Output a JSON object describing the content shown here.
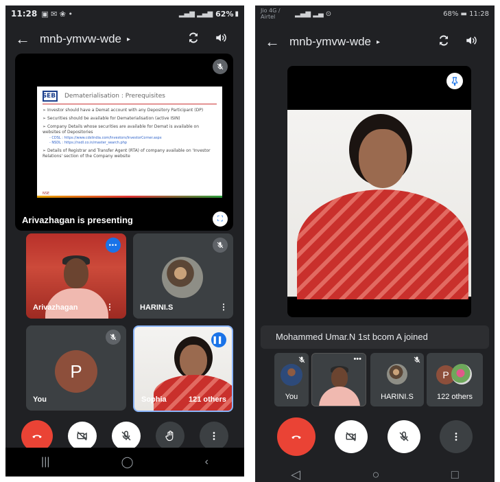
{
  "left": {
    "status": {
      "time": "11:28",
      "notif_glyphs": "▣ ✉ ❀ •",
      "battery": "62%"
    },
    "appbar": {
      "back_icon": "back-arrow-icon",
      "meeting_code": "mnb-ymvw-wde",
      "caret": "▸"
    },
    "presentation": {
      "label": "Arivazhagan is presenting",
      "slide": {
        "logo": "SEBI",
        "title": "Dematerialisation : Prerequisites",
        "bullets": [
          "Investor should have a Demat account with any Depository Participant (DP)",
          "Securities should be available for Dematerialisation (active ISIN)",
          "Company Details whose securities are available for Demat is available on websites of Depositories",
          "Details of Registrar and Transfer Agent (RTA) of company available on 'Investor Relations' section of the Company website"
        ],
        "links": [
          "- CDSL : https://www.cdslindia.com/Investors/InvestorCorner.aspx",
          "- NSDL : https://nsdl.co.in/master_search.php"
        ],
        "footer": "NSE"
      }
    },
    "tiles": [
      {
        "name": "Arivazhagan",
        "more": "⋮"
      },
      {
        "name": "HARINI.S",
        "more": "⋮"
      },
      {
        "name": "You",
        "avatar_letter": "P"
      },
      {
        "name": "Sophia",
        "others": "121 others"
      }
    ],
    "nav": {
      "recents": "|||",
      "home": "◯",
      "back": "‹"
    }
  },
  "right": {
    "status": {
      "carrier": "Jio 4G / Airtel",
      "battery_time": "68%  ▬ 11:28"
    },
    "appbar": {
      "meeting_code": "mnb-ymvw-wde",
      "caret": "▸"
    },
    "toast": "Mohammed Umar.N 1st bcom A joined",
    "strip": [
      {
        "name": "You"
      },
      {
        "name": ""
      },
      {
        "name": "HARINI.S"
      },
      {
        "name": "122 others",
        "avatar_letter": "P"
      }
    ],
    "nav": {
      "back": "◁",
      "home": "○",
      "recents": "□"
    }
  },
  "colors": {
    "background": "#202124",
    "tile": "#3c4043",
    "end_call": "#ea4335",
    "accent_blue": "#1a73e8",
    "avatar_brown": "#8d4f3b"
  }
}
